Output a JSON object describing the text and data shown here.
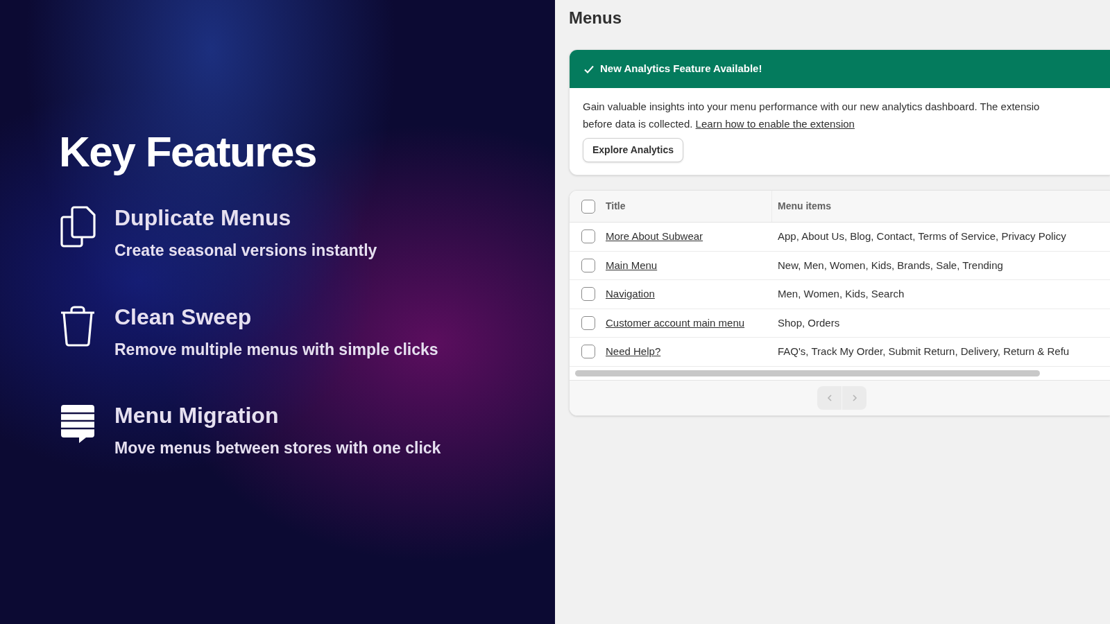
{
  "promo": {
    "title": "Key Features",
    "features": [
      {
        "kind": "copy",
        "title": "Duplicate Menus",
        "description": "Create seasonal versions instantly"
      },
      {
        "kind": "trash",
        "title": "Clean Sweep",
        "description": "Remove multiple menus with simple clicks"
      },
      {
        "kind": "stack",
        "title": "Menu Migration",
        "description": "Move menus between stores with one click"
      }
    ]
  },
  "app": {
    "page_title": "Menus",
    "banner": {
      "title": "New Analytics Feature Available!",
      "body": "Gain valuable insights into your menu performance with our new analytics dashboard. The extensio",
      "body_end": "before data is collected.",
      "link": "Learn how to enable the extension",
      "button": "Explore Analytics"
    },
    "table": {
      "select_all_checked": false,
      "columns": [
        "Title",
        "Menu items"
      ],
      "rows": [
        {
          "checked": false,
          "title": "More About Subwear",
          "items": "App, About Us, Blog, Contact, Terms of Service, Privacy Policy"
        },
        {
          "checked": false,
          "title": "Main Menu",
          "items": "New, Men, Women, Kids, Brands, Sale, Trending"
        },
        {
          "checked": false,
          "title": "Navigation",
          "items": "Men, Women, Kids, Search"
        },
        {
          "checked": false,
          "title": "Customer account main menu",
          "items": "Shop, Orders"
        },
        {
          "checked": false,
          "title": "Need Help?",
          "items": "FAQ's, Track My Order, Submit Return, Delivery, Return & Refu"
        }
      ]
    },
    "pagination": {
      "previous_disabled": true,
      "next_disabled": true
    }
  }
}
